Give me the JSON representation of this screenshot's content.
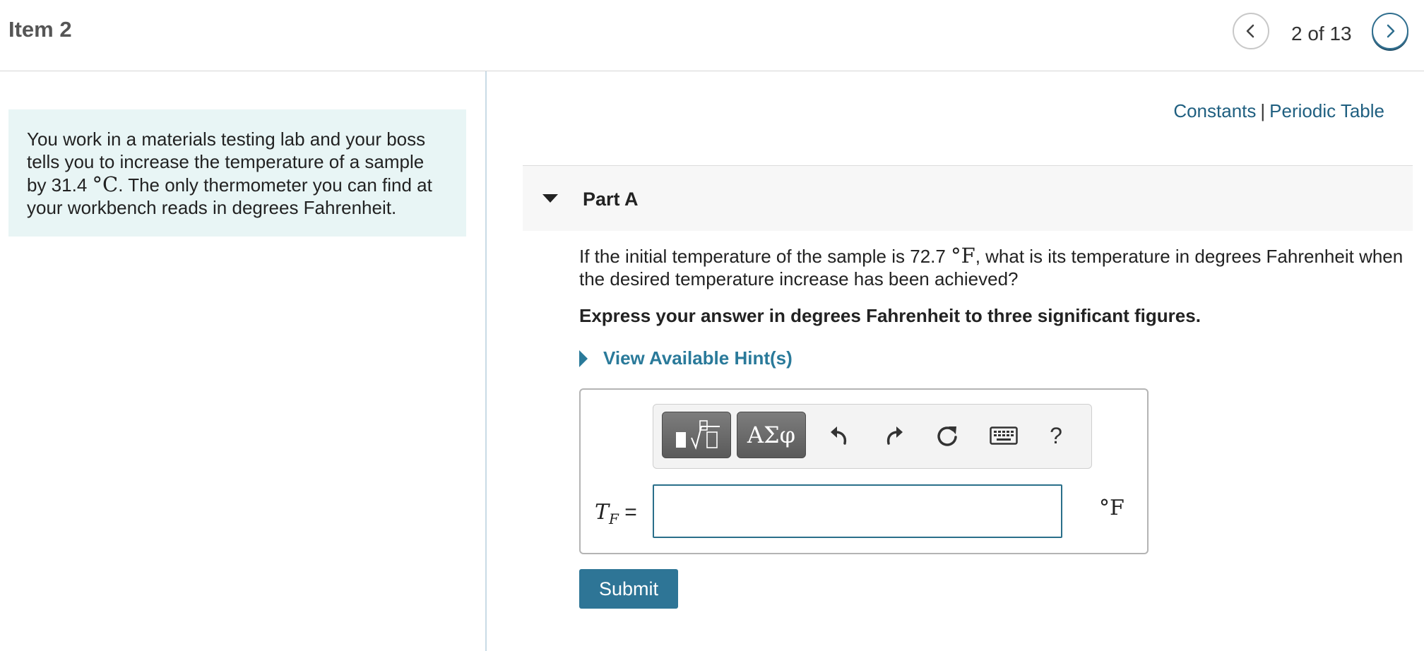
{
  "header": {
    "item_title": "Item 2",
    "counter": "2 of 13",
    "prev_icon": "chevron-left-icon",
    "next_icon": "chevron-right-icon"
  },
  "intro": {
    "text_before": "You work in a materials testing lab and your boss tells you to increase the temperature of a sample by 31.4 ",
    "unit": "°C",
    "text_after": ". The only thermometer you can find at your workbench reads in degrees Fahrenheit."
  },
  "links": {
    "constants": "Constants",
    "separator": "|",
    "periodic_table": "Periodic Table"
  },
  "part": {
    "title": "Part A",
    "question_before": "If the initial temperature of the sample is 72.7 ",
    "question_unit": "°F",
    "question_after": ", what is its temperature in degrees Fahrenheit when the desired temperature increase has been achieved?",
    "instruction": "Express your answer in degrees Fahrenheit to three significant figures.",
    "hint_label": "View Available Hint(s)"
  },
  "answer": {
    "variable": "T",
    "subscript": "F",
    "equals": "=",
    "value": "",
    "unit": "°F",
    "toolbar": {
      "greek_label": "ΑΣφ",
      "help_label": "?",
      "icons": [
        "templates-icon",
        "undo-icon",
        "redo-icon",
        "reset-icon",
        "keyboard-icon",
        "help-icon"
      ]
    }
  },
  "submit_label": "Submit",
  "colors": {
    "accent": "#2e7596",
    "link": "#1f5f80",
    "intro_bg": "#e8f5f5"
  }
}
